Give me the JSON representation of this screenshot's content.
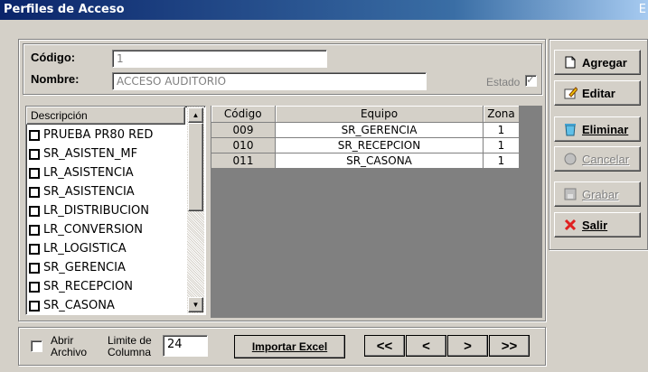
{
  "window": {
    "title": "Perfiles de Acceso",
    "edge_glyph": "E"
  },
  "header": {
    "codigo_label": "Código:",
    "codigo_value": "1",
    "nombre_label": "Nombre:",
    "nombre_value": "ACCESO AUDITORIO",
    "estado_label": "Estado",
    "estado_checked": true
  },
  "list": {
    "header": "Descripción",
    "items": [
      "PRUEBA PR80 RED",
      "SR_ASISTEN_MF",
      "LR_ASISTENCIA",
      "SR_ASISTENCIA",
      "LR_DISTRIBUCION",
      "LR_CONVERSION",
      "LR_LOGISTICA",
      "SR_GERENCIA",
      "SR_RECEPCION",
      "SR_CASONA"
    ]
  },
  "grid": {
    "columns": [
      "Código",
      "Equipo",
      "Zona"
    ],
    "rows": [
      [
        "009",
        "SR_GERENCIA",
        "1"
      ],
      [
        "010",
        "SR_RECEPCION",
        "1"
      ],
      [
        "011",
        "SR_CASONA",
        "1"
      ]
    ]
  },
  "actions": {
    "agregar": "Agregar",
    "editar": "Editar",
    "eliminar": "Eliminar",
    "cancelar": "Cancelar",
    "grabar": "Grabar",
    "salir": "Salir"
  },
  "footer": {
    "abrir_line1": "Abrir",
    "abrir_line2": "Archivo",
    "limite_line1": "Limite de",
    "limite_line2": "Columna",
    "limite_value": "24",
    "import_label": "Importar Excel",
    "nav_first": "<<",
    "nav_prev": "<",
    "nav_next": ">",
    "nav_last": ">>"
  },
  "colors": {
    "title_start": "#0a246a",
    "title_end": "#a6caf0",
    "face": "#d4d0c8",
    "grid_bg": "#808080"
  }
}
